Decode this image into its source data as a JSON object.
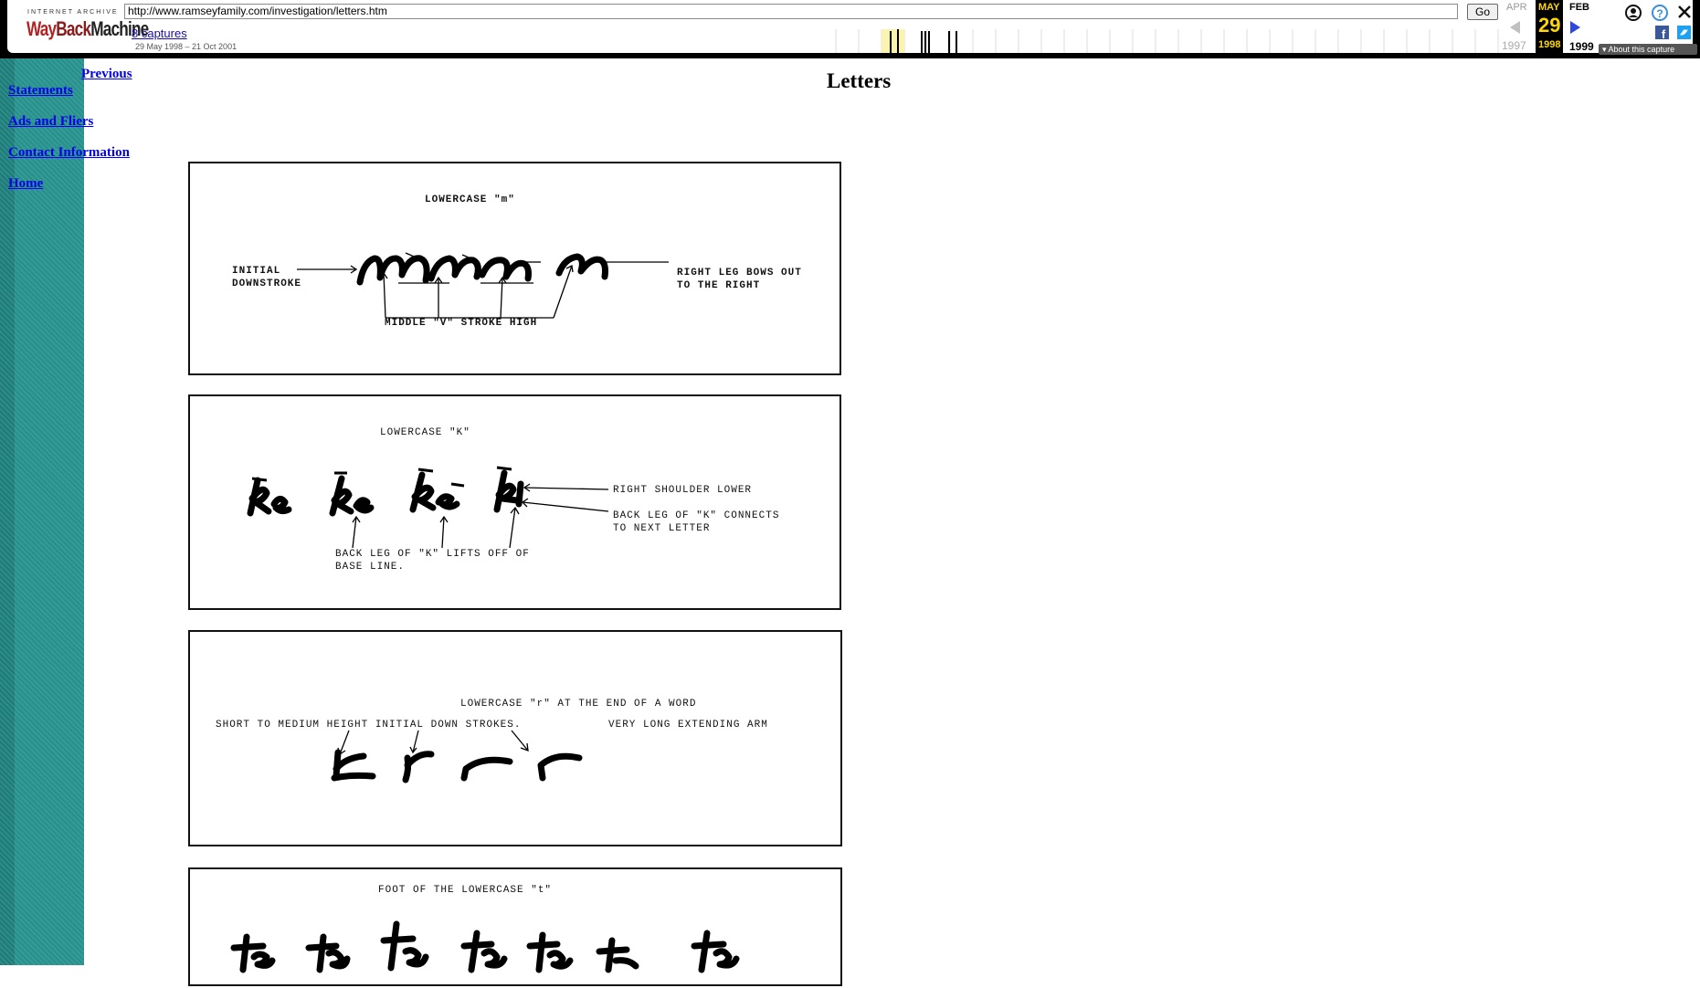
{
  "toolbar": {
    "logo_top": "INTERNET ARCHIVE",
    "logo_way": "Way",
    "logo_back": "Back",
    "logo_machine": "Machine",
    "url": "http://www.ramseyfamily.com/investigation/letters.htm",
    "go_label": "Go",
    "captures": "8 captures",
    "date_range": "29 May 1998 – 21 Oct 2001",
    "prev_month": "APR",
    "cur_month": "MAY",
    "next_month": "FEB",
    "cur_day": "29",
    "prev_year": "1997",
    "cur_year": "1998",
    "next_year": "1999",
    "about": "About this capture"
  },
  "nav": {
    "previous": "Previous",
    "statements": "Statements",
    "ads": "Ads and Fliers",
    "contact": "Contact Information",
    "home": "Home"
  },
  "page": {
    "title": "Letters"
  },
  "figures": {
    "m": {
      "heading": "LOWERCASE \"m\"",
      "left_label_1": "INITIAL",
      "left_label_2": "DOWNSTROKE",
      "right_label_1": "RIGHT LEG BOWS OUT",
      "right_label_2": "TO THE RIGHT",
      "bottom_label": "MIDDLE \"V\" STROKE HIGH"
    },
    "k": {
      "heading": "LOWERCASE \"K\"",
      "right_label_1": "RIGHT SHOULDER LOWER",
      "right_label_2": "BACK LEG OF \"K\" CONNECTS",
      "right_label_3": "TO NEXT LETTER",
      "bottom_label_1": "BACK LEG OF \"K\" LIFTS OFF OF",
      "bottom_label_2": "BASE LINE."
    },
    "r": {
      "heading": "LOWERCASE \"r\" AT THE END OF A WORD",
      "left_label": "SHORT TO MEDIUM HEIGHT INITIAL DOWN STROKES.",
      "right_label": "VERY LONG EXTENDING ARM"
    },
    "t": {
      "heading": "FOOT OF THE LOWERCASE \"t\""
    }
  }
}
